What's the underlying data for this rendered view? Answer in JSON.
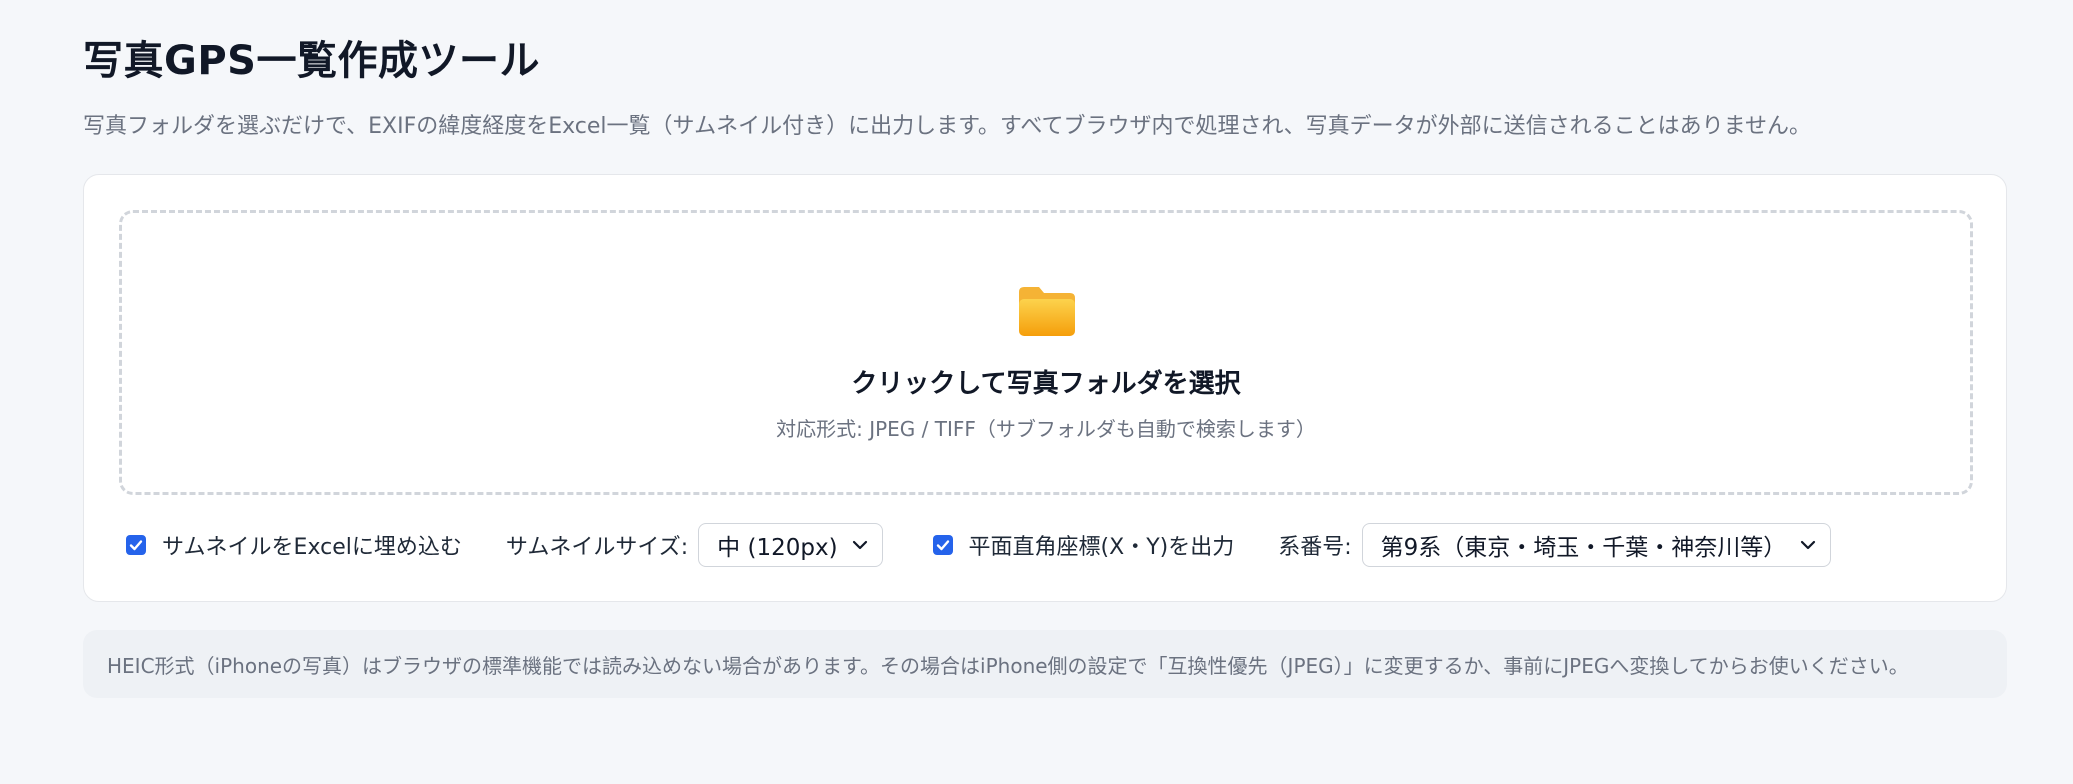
{
  "header": {
    "title": "写真GPS一覧作成ツール",
    "description": "写真フォルダを選ぶだけで、EXIFの緯度経度をExcel一覧（サムネイル付き）に出力します。すべてブラウザ内で処理され、写真データが外部に送信されることはありません。"
  },
  "dropzone": {
    "icon": "folder-icon",
    "title": "クリックして写真フォルダを選択",
    "subtitle": "対応形式: JPEG / TIFF（サブフォルダも自動で検索します）"
  },
  "options": {
    "embed_thumbnail": {
      "label": "サムネイルをExcelに埋め込む",
      "checked": true
    },
    "thumbnail_size": {
      "label": "サムネイルサイズ:",
      "selected": "中 (120px)"
    },
    "plane_coords": {
      "label": "平面直角座標(X・Y)を出力",
      "checked": true
    },
    "system_number": {
      "label": "系番号:",
      "selected": "第9系（東京・埼玉・千葉・神奈川等）"
    }
  },
  "note": "HEIC形式（iPhoneの写真）はブラウザの標準機能では読み込めない場合があります。その場合はiPhone側の設定で「互換性優先（JPEG）」に変更するか、事前にJPEGへ変換してからお使いください。",
  "colors": {
    "accent": "#2563eb",
    "folder": "#fbbf24"
  }
}
